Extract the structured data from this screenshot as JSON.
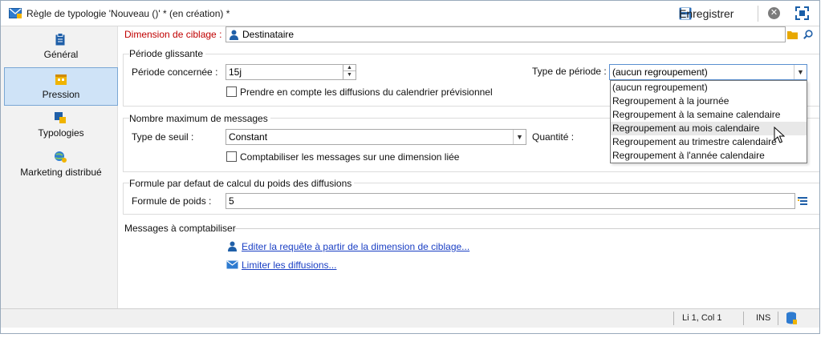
{
  "window": {
    "title": "Règle de typologie 'Nouveau ()' * (en création) *",
    "save_label": "Enregistrer",
    "close_symbol": "✕"
  },
  "sidebar": {
    "items": [
      {
        "label": "Général",
        "icon": "clipboard-icon"
      },
      {
        "label": "Pression",
        "icon": "calendar-icon",
        "active": true
      },
      {
        "label": "Typologies",
        "icon": "typology-icon"
      },
      {
        "label": "Marketing distribué",
        "icon": "globe-user-icon"
      }
    ]
  },
  "targeting": {
    "label": "Dimension de ciblage :",
    "value": "Destinataire"
  },
  "rolling_period": {
    "title": "Période glissante",
    "period_label": "Période concernée :",
    "period_value": "15j",
    "calendar_checkbox_label": "Prendre en compte les diffusions du calendrier prévisionnel",
    "calendar_checkbox_checked": false,
    "period_type_label": "Type de période :",
    "period_type_value": "(aucun regroupement)"
  },
  "period_type_options": [
    "(aucun regroupement)",
    "Regroupement à la journée",
    "Regroupement à la semaine calendaire",
    "Regroupement au mois calendaire",
    "Regroupement au trimestre calendaire",
    "Regroupement à l'année calendaire"
  ],
  "max_messages": {
    "title": "Nombre maximum de messages",
    "threshold_label": "Type de seuil :",
    "threshold_value": "Constant",
    "quantity_label": "Quantité :",
    "linked_dimension_label": "Comptabiliser les messages sur une dimension liée",
    "linked_dimension_checked": false
  },
  "weight_formula": {
    "title": "Formule par defaut de calcul du poids des diffusions",
    "label": "Formule de poids :",
    "value": "5"
  },
  "messages": {
    "title": "Messages à comptabiliser",
    "link_query": "Editer la requête à partir de la dimension de ciblage...",
    "link_limit": "Limiter les diffusions..."
  },
  "status": {
    "position": "Li 1, Col 1",
    "mode": "INS"
  },
  "colors": {
    "accent": "#1a6fc4",
    "required_label": "#c00000",
    "link": "#1a3fc4",
    "active_nav_bg": "#cfe3f7"
  }
}
